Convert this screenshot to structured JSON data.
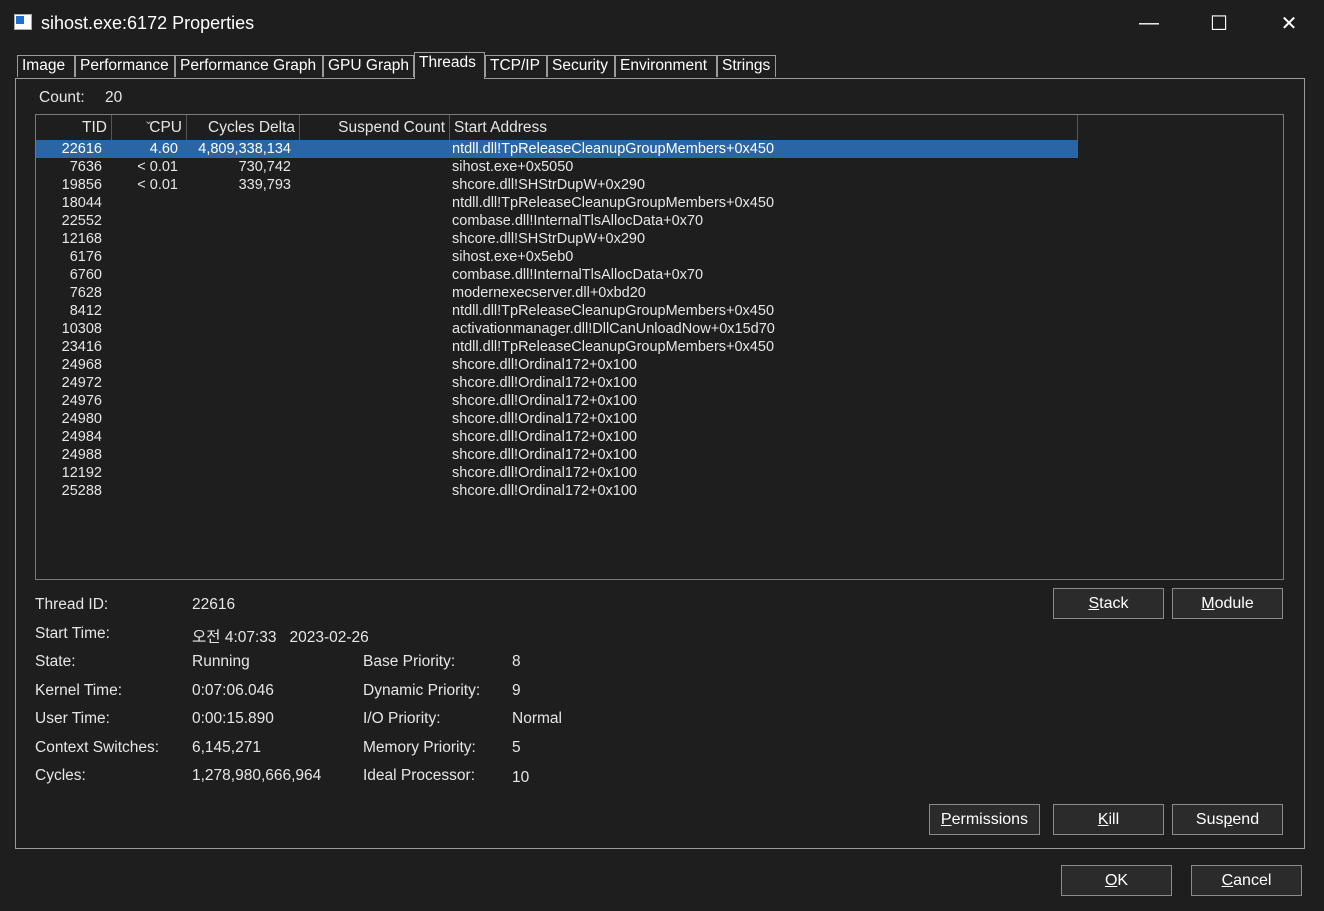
{
  "window": {
    "title": "sihost.exe:6172 Properties",
    "minimize": "—",
    "maximize": "☐",
    "close": "✕"
  },
  "tabs": [
    "Image",
    "Performance",
    "Performance Graph",
    "GPU Graph",
    "Threads",
    "TCP/IP",
    "Security",
    "Environment",
    "Strings"
  ],
  "active_tab": "Threads",
  "count": {
    "label": "Count:",
    "value": "20"
  },
  "columns": [
    "TID",
    "CPU",
    "Cycles Delta",
    "Suspend Count",
    "Start Address"
  ],
  "threads": [
    {
      "tid": "22616",
      "cpu": "4.60",
      "cycles": "4,809,338,134",
      "suspend": "",
      "address": "ntdll.dll!TpReleaseCleanupGroupMembers+0x450"
    },
    {
      "tid": "7636",
      "cpu": "< 0.01",
      "cycles": "730,742",
      "suspend": "",
      "address": "sihost.exe+0x5050"
    },
    {
      "tid": "19856",
      "cpu": "< 0.01",
      "cycles": "339,793",
      "suspend": "",
      "address": "shcore.dll!SHStrDupW+0x290"
    },
    {
      "tid": "18044",
      "cpu": "",
      "cycles": "",
      "suspend": "",
      "address": "ntdll.dll!TpReleaseCleanupGroupMembers+0x450"
    },
    {
      "tid": "22552",
      "cpu": "",
      "cycles": "",
      "suspend": "",
      "address": "combase.dll!InternalTlsAllocData+0x70"
    },
    {
      "tid": "12168",
      "cpu": "",
      "cycles": "",
      "suspend": "",
      "address": "shcore.dll!SHStrDupW+0x290"
    },
    {
      "tid": "6176",
      "cpu": "",
      "cycles": "",
      "suspend": "",
      "address": "sihost.exe+0x5eb0"
    },
    {
      "tid": "6760",
      "cpu": "",
      "cycles": "",
      "suspend": "",
      "address": "combase.dll!InternalTlsAllocData+0x70"
    },
    {
      "tid": "7628",
      "cpu": "",
      "cycles": "",
      "suspend": "",
      "address": "modernexecserver.dll+0xbd20"
    },
    {
      "tid": "8412",
      "cpu": "",
      "cycles": "",
      "suspend": "",
      "address": "ntdll.dll!TpReleaseCleanupGroupMembers+0x450"
    },
    {
      "tid": "10308",
      "cpu": "",
      "cycles": "",
      "suspend": "",
      "address": "activationmanager.dll!DllCanUnloadNow+0x15d70"
    },
    {
      "tid": "23416",
      "cpu": "",
      "cycles": "",
      "suspend": "",
      "address": "ntdll.dll!TpReleaseCleanupGroupMembers+0x450"
    },
    {
      "tid": "24968",
      "cpu": "",
      "cycles": "",
      "suspend": "",
      "address": "shcore.dll!Ordinal172+0x100"
    },
    {
      "tid": "24972",
      "cpu": "",
      "cycles": "",
      "suspend": "",
      "address": "shcore.dll!Ordinal172+0x100"
    },
    {
      "tid": "24976",
      "cpu": "",
      "cycles": "",
      "suspend": "",
      "address": "shcore.dll!Ordinal172+0x100"
    },
    {
      "tid": "24980",
      "cpu": "",
      "cycles": "",
      "suspend": "",
      "address": "shcore.dll!Ordinal172+0x100"
    },
    {
      "tid": "24984",
      "cpu": "",
      "cycles": "",
      "suspend": "",
      "address": "shcore.dll!Ordinal172+0x100"
    },
    {
      "tid": "24988",
      "cpu": "",
      "cycles": "",
      "suspend": "",
      "address": "shcore.dll!Ordinal172+0x100"
    },
    {
      "tid": "12192",
      "cpu": "",
      "cycles": "",
      "suspend": "",
      "address": "shcore.dll!Ordinal172+0x100"
    },
    {
      "tid": "25288",
      "cpu": "",
      "cycles": "",
      "suspend": "",
      "address": "shcore.dll!Ordinal172+0x100"
    }
  ],
  "details": {
    "thread_id": {
      "label": "Thread ID:",
      "value": "22616"
    },
    "start_time": {
      "label": "Start Time:",
      "value": "오전 4:07:33   2023-02-26"
    },
    "state": {
      "label": "State:",
      "value": "Running"
    },
    "kernel_time": {
      "label": "Kernel Time:",
      "value": "0:07:06.046"
    },
    "user_time": {
      "label": "User Time:",
      "value": "0:00:15.890"
    },
    "context_switches": {
      "label": "Context Switches:",
      "value": "6,145,271"
    },
    "cycles": {
      "label": "Cycles:",
      "value": "1,278,980,666,964"
    },
    "base_priority": {
      "label": "Base Priority:",
      "value": "8"
    },
    "dynamic_priority": {
      "label": "Dynamic Priority:",
      "value": "9"
    },
    "io_priority": {
      "label": "I/O Priority:",
      "value": "Normal"
    },
    "memory_priority": {
      "label": "Memory Priority:",
      "value": "5"
    },
    "ideal_processor": {
      "label": "Ideal Processor:",
      "value": "10"
    }
  },
  "buttons": {
    "stack": {
      "label": "Stack",
      "accel": "S",
      "rest": "tack"
    },
    "module": {
      "label": "Module",
      "accel": "M",
      "rest": "odule"
    },
    "permissions": {
      "label": "Permissions",
      "accel": "P",
      "rest": "ermissions"
    },
    "kill": {
      "label": "Kill",
      "accel": "K",
      "rest": "ill"
    },
    "suspend": {
      "label": "Suspend",
      "pre": "Sus",
      "accel": "p",
      "rest": "end"
    },
    "ok": {
      "label": "OK",
      "accel": "O",
      "rest": "K"
    },
    "cancel": {
      "label": "Cancel",
      "accel": "C",
      "rest": "ancel"
    }
  },
  "colors": {
    "background": "#1e1e1e",
    "selection": "#2a65a5",
    "border": "#9a9a9a",
    "text": "#e6e6e6"
  }
}
